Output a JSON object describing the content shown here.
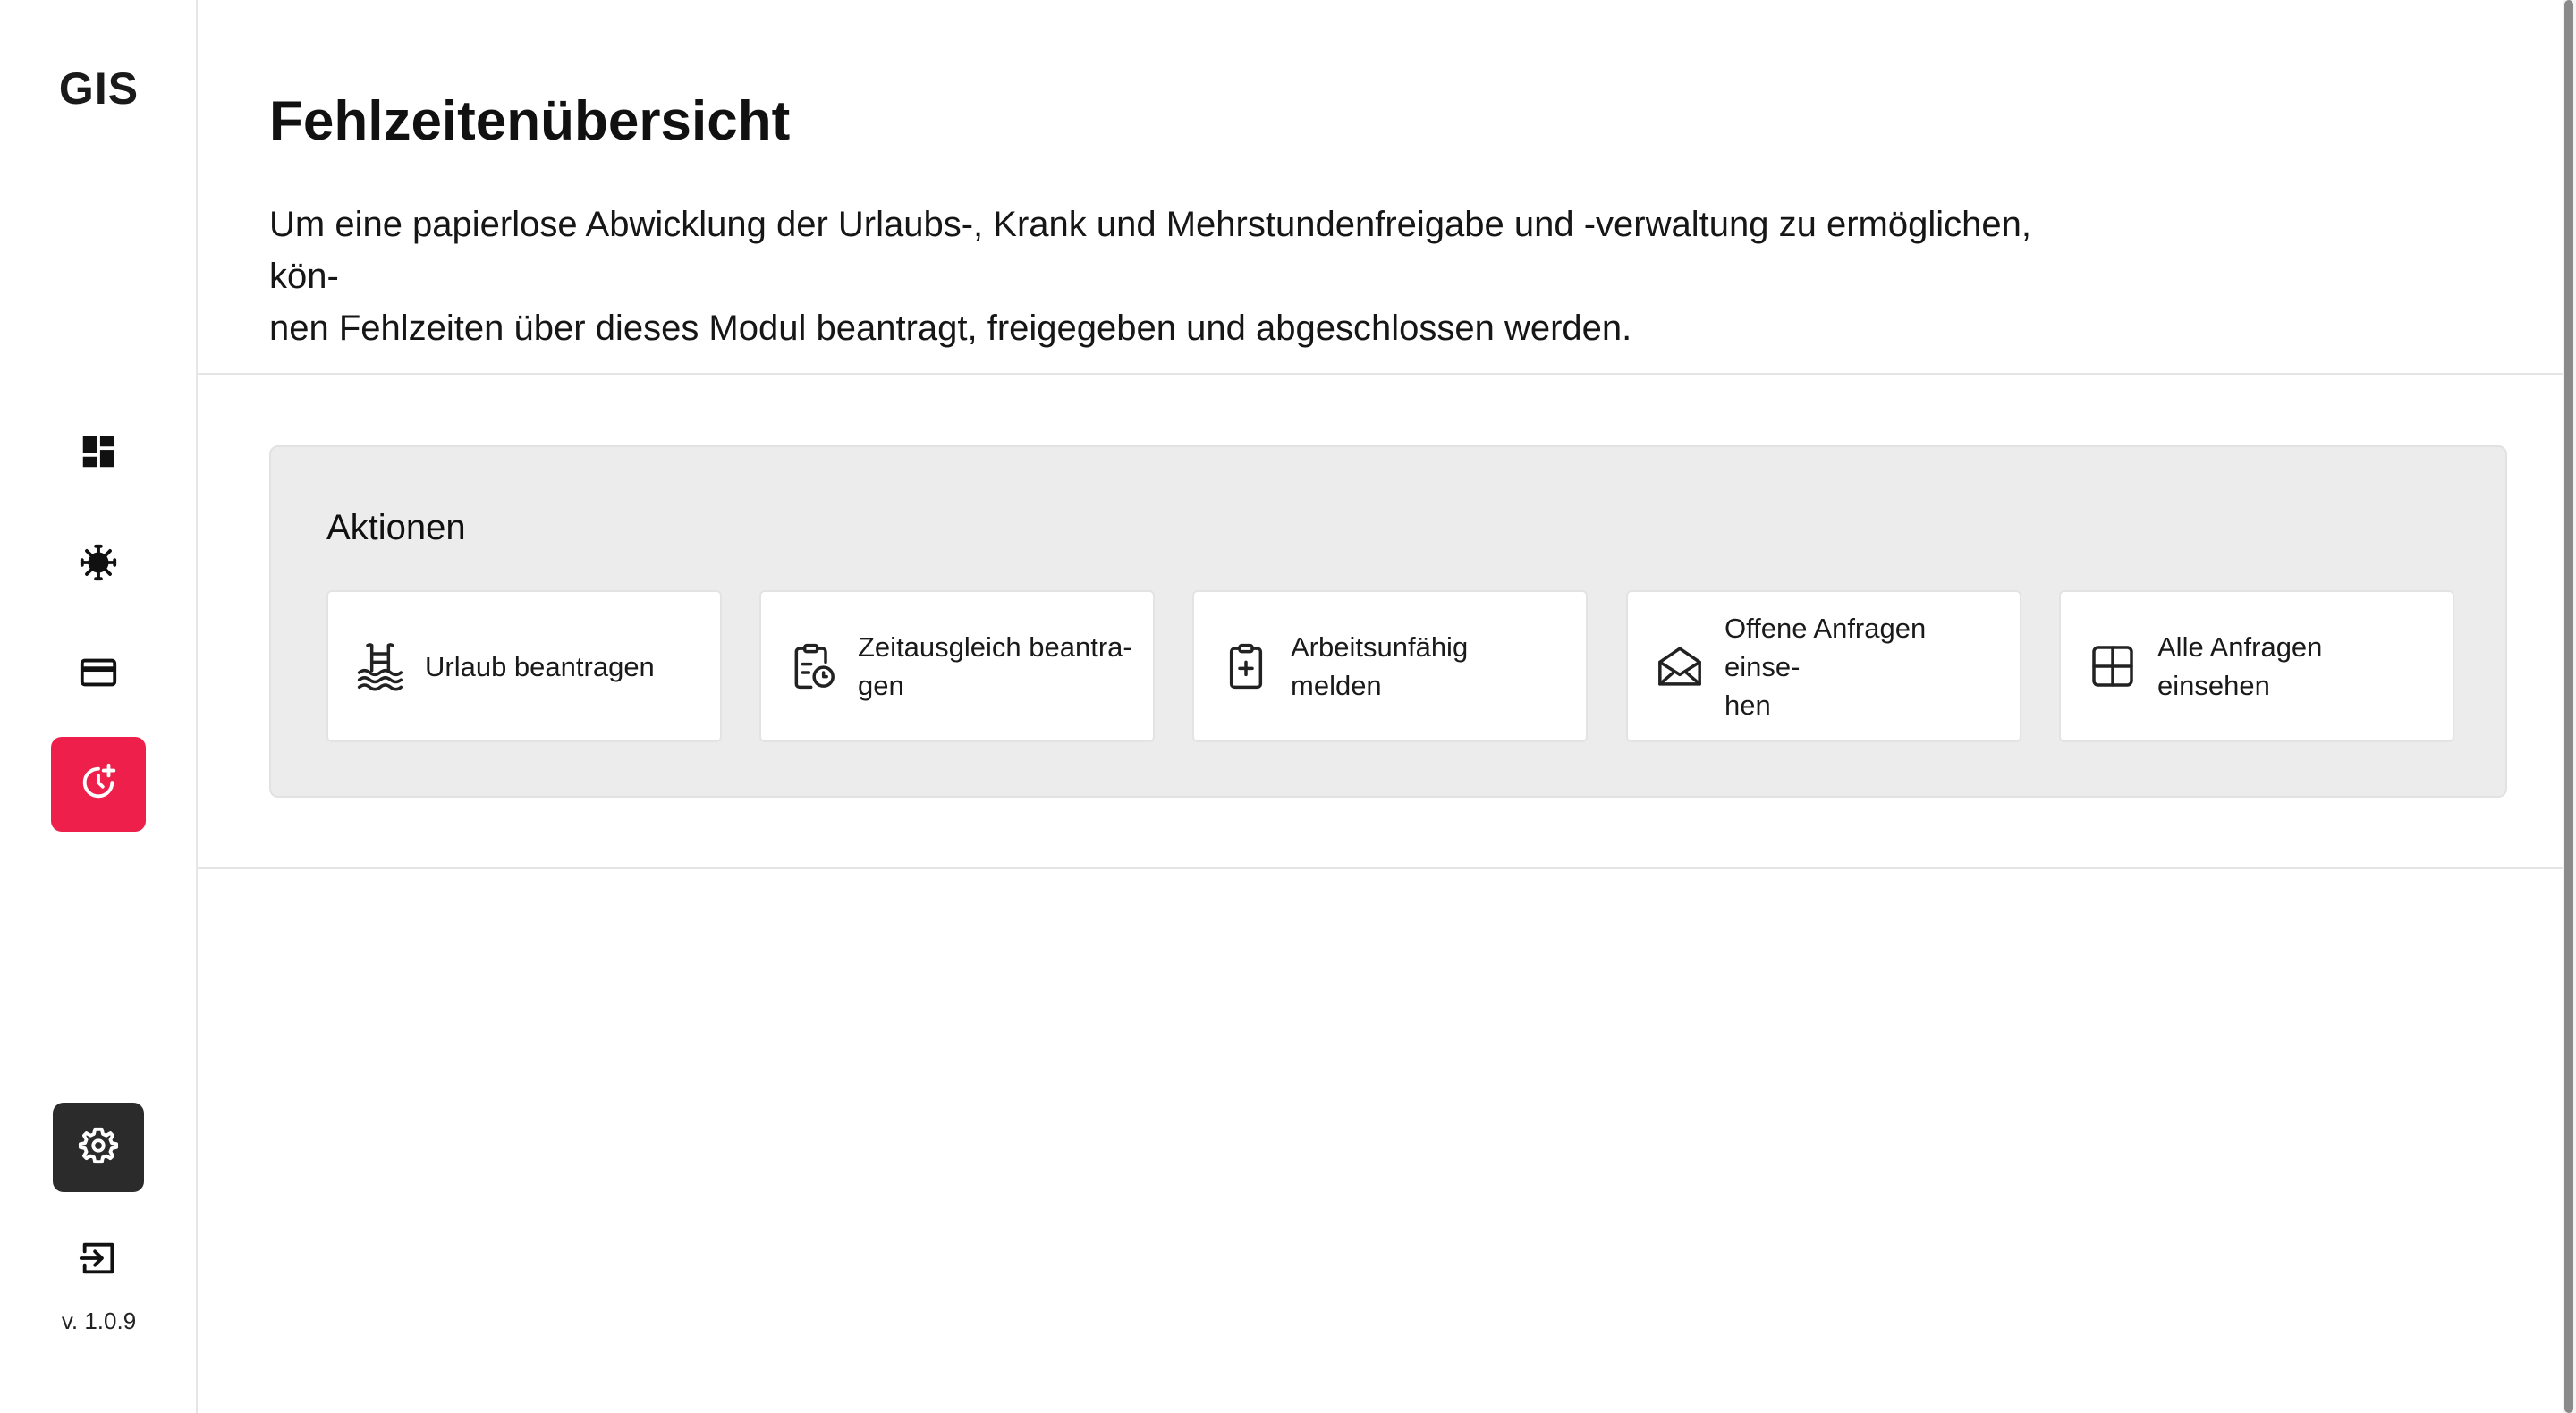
{
  "brand": {
    "logo": "GIS"
  },
  "sidebar": {
    "items": [
      {
        "icon": "dashboard-icon",
        "active": false
      },
      {
        "icon": "virus-icon",
        "active": false
      },
      {
        "icon": "credit-card-icon",
        "active": false
      },
      {
        "icon": "clock-plus-icon",
        "active": true
      }
    ],
    "settings_icon": "gear-icon",
    "logout_icon": "logout-icon",
    "version": "v. 1.0.9"
  },
  "page": {
    "title": "Fehlzeitenübersicht",
    "intro_line1": "Um eine papierlose Abwicklung der Urlaubs-, Krank und Mehrstundenfreigabe und -verwaltung zu ermöglichen, kön-",
    "intro_line2": "nen Fehlzeiten über dieses Modul beantragt, freigegeben und abgeschlossen werden."
  },
  "actions": {
    "title": "Aktionen",
    "items": [
      {
        "label_line1": "Urlaub beantragen",
        "label_line2": "",
        "icon": "swimming-icon"
      },
      {
        "label_line1": "Zeitausgleich beantra-",
        "label_line2": "gen",
        "icon": "clipboard-clock-icon"
      },
      {
        "label_line1": "Arbeitsunfähig melden",
        "label_line2": "",
        "icon": "clipboard-plus-icon"
      },
      {
        "label_line1": "Offene Anfragen einse-",
        "label_line2": "hen",
        "icon": "open-mail-icon"
      },
      {
        "label_line1": "Alle Anfragen einsehen",
        "label_line2": "",
        "icon": "grid-icon"
      }
    ]
  },
  "colors": {
    "accent": "#ee1f4b",
    "dark_button": "#2b2b2b",
    "panel_background": "#ececec"
  }
}
